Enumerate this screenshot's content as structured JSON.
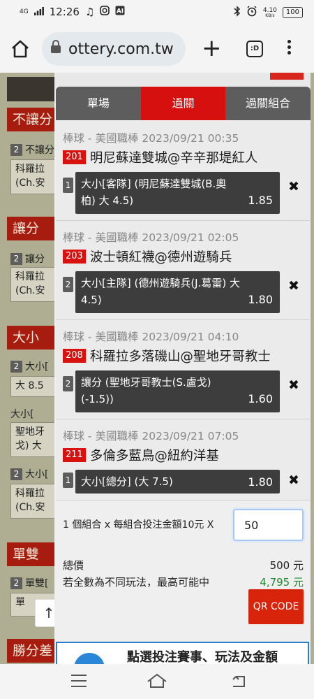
{
  "status_bar": {
    "signal_label": "4G",
    "time": "12:26",
    "network_speed": "4.10",
    "network_unit": "KB/s",
    "battery": "100"
  },
  "browser": {
    "url": "ottery.com.tw"
  },
  "background_page": {
    "sections": [
      {
        "title": "不讓分",
        "row_num": "2",
        "row_text": "不讓分",
        "box_text": "科羅拉(Ch.安"
      },
      {
        "title": "讓分",
        "row_num": "2",
        "row_text": "讓分",
        "box_text": "科羅拉(Ch.安"
      },
      {
        "title": "大小",
        "row_num": "2",
        "row_text": "大小[",
        "box_text": "大 8.5"
      },
      {
        "title": "",
        "row_num": "",
        "row_text": "大小[",
        "box_text": "聖地牙戈) 大"
      },
      {
        "title": "",
        "row_num": "2",
        "row_text": "大小[",
        "box_text": "科羅拉(Ch.安"
      },
      {
        "title": "單雙",
        "row_num": "2",
        "row_text": "單雙[",
        "box_text": "單"
      },
      {
        "title": "勝分差",
        "row_num": "",
        "row_text": "",
        "box_text": ""
      }
    ],
    "scroll_top_label": "↑"
  },
  "cart": {
    "tabs": [
      "單場",
      "過關",
      "過關組合"
    ],
    "active_tab": "過關",
    "bets": [
      {
        "meta": "棒球 - 美國職棒 2023/09/21 00:35",
        "game_no": "201",
        "match": "明尼蘇達雙城@辛辛那堤紅人",
        "sel_num": "1",
        "selection": "大小[客隊] (明尼蘇達雙城(B.奧柏) 大 4.5)",
        "odds": "1.85"
      },
      {
        "meta": "棒球 - 美國職棒 2023/09/21 02:05",
        "game_no": "203",
        "match": "波士頓紅襪@德州遊騎兵",
        "sel_num": "2",
        "selection": "大小[主隊] (德州遊騎兵(J.葛雷) 大 4.5)",
        "odds": "1.80"
      },
      {
        "meta": "棒球 - 美國職棒 2023/09/21 04:10",
        "game_no": "208",
        "match": "科羅拉多落磯山@聖地牙哥教士",
        "sel_num": "2",
        "selection": "讓分 (聖地牙哥教士(S.盧戈) (-1.5))",
        "odds": "1.60"
      },
      {
        "meta": "棒球 - 美國職棒 2023/09/21 07:05",
        "game_no": "211",
        "match": "多倫多藍鳥@紐約洋基",
        "sel_num": "1",
        "selection": "大小[總分] (大 7.5)",
        "odds": "1.80"
      }
    ],
    "remove_label": "✖",
    "combo_text": "1 個組合 x 每組合投注金額10元 X",
    "amount_value": "50",
    "total_label": "總價",
    "total_value": "500 元",
    "max_label": "若全數為不同玩法，最高可能中",
    "max_value": "4,795 元",
    "qr_label": "QR CODE",
    "banner_text": "點選投注賽事、玩法及金額",
    "colors": {
      "accent_red": "#d60f0f",
      "max_green": "#1b8a2c"
    }
  }
}
